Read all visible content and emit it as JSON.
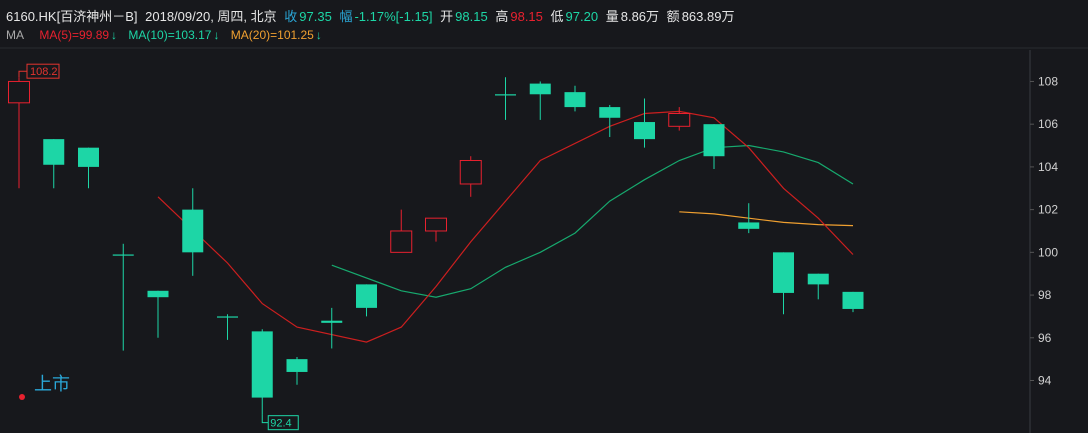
{
  "header": {
    "stock": "6160.HK[百济神州－B]",
    "date": "2018/09/20, 周四, 北京",
    "close_label": "收",
    "close": "97.35",
    "change_label": "幅",
    "change_pct": "-1.17%",
    "change_abs": "[-1.15]",
    "open_label": "开",
    "open": "98.15",
    "high_label": "高",
    "high": "98.15",
    "low_label": "低",
    "low": "97.20",
    "volume_label": "量",
    "volume": "8.86万",
    "amount_label": "额",
    "amount": "863.89万"
  },
  "ma_legend": {
    "label": "MA",
    "ma5": "MA(5)=99.89",
    "ma10": "MA(10)=103.17",
    "ma20": "MA(20)=101.25",
    "arrow": "↓"
  },
  "colors": {
    "up": "#e8212f",
    "down": "#1dd6a6",
    "ma5": "#cc1f1f",
    "ma10": "#17a96e",
    "ma20": "#f0a030",
    "axis_text": "#d0d0d0",
    "grid": "#2c2e33",
    "label_up": "#e3342f",
    "label_down": "#1dd6a6",
    "marker": "#e8212f",
    "event_text": "#2aa7d8"
  },
  "chart_data": {
    "type": "candlestick",
    "ylim": [
      92.0,
      109.5
    ],
    "yticks": [
      94,
      96,
      98,
      100,
      102,
      104,
      106,
      108
    ],
    "candles": [
      {
        "o": 107.0,
        "c": 108.0,
        "h": 108.2,
        "l": 103.0
      },
      {
        "o": 105.3,
        "c": 104.1,
        "h": 105.3,
        "l": 103.0
      },
      {
        "o": 104.9,
        "c": 104.0,
        "h": 104.9,
        "l": 103.0
      },
      {
        "o": 99.9,
        "c": 99.9,
        "h": 100.4,
        "l": 95.4
      },
      {
        "o": 98.2,
        "c": 97.9,
        "h": 98.2,
        "l": 96.0
      },
      {
        "o": 102.0,
        "c": 100.0,
        "h": 103.0,
        "l": 98.9
      },
      {
        "o": 97.0,
        "c": 97.0,
        "h": 97.1,
        "l": 95.9
      },
      {
        "o": 96.3,
        "c": 93.2,
        "h": 96.4,
        "l": 92.4
      },
      {
        "o": 95.0,
        "c": 94.4,
        "h": 95.1,
        "l": 93.8
      },
      {
        "o": 96.8,
        "c": 96.7,
        "h": 97.4,
        "l": 95.5
      },
      {
        "o": 98.5,
        "c": 97.4,
        "h": 98.5,
        "l": 97.0
      },
      {
        "o": 100.0,
        "c": 101.0,
        "h": 102.0,
        "l": 100.0
      },
      {
        "o": 101.0,
        "c": 101.6,
        "h": 101.6,
        "l": 100.5
      },
      {
        "o": 103.2,
        "c": 104.3,
        "h": 104.5,
        "l": 102.6
      },
      {
        "o": 107.4,
        "c": 107.4,
        "h": 108.2,
        "l": 106.2
      },
      {
        "o": 107.9,
        "c": 107.4,
        "h": 108.0,
        "l": 106.2
      },
      {
        "o": 107.5,
        "c": 106.8,
        "h": 107.8,
        "l": 106.6
      },
      {
        "o": 106.8,
        "c": 106.3,
        "h": 106.9,
        "l": 105.4
      },
      {
        "o": 106.1,
        "c": 105.3,
        "h": 107.2,
        "l": 104.9
      },
      {
        "o": 105.9,
        "c": 106.5,
        "h": 106.8,
        "l": 105.7
      },
      {
        "o": 106.0,
        "c": 104.5,
        "h": 106.0,
        "l": 103.9
      },
      {
        "o": 101.4,
        "c": 101.1,
        "h": 102.3,
        "l": 100.9
      },
      {
        "o": 100.0,
        "c": 98.1,
        "h": 100.0,
        "l": 97.1
      },
      {
        "o": 99.0,
        "c": 98.5,
        "h": 99.0,
        "l": 97.8
      },
      {
        "o": 98.15,
        "c": 97.35,
        "h": 98.15,
        "l": 97.2
      }
    ],
    "ma5": [
      [
        4,
        102.6
      ],
      [
        6,
        99.5
      ],
      [
        7,
        97.6
      ],
      [
        8,
        96.5
      ],
      [
        10,
        95.8
      ],
      [
        11,
        96.5
      ],
      [
        12,
        98.4
      ],
      [
        13,
        100.5
      ],
      [
        15,
        104.3
      ],
      [
        17,
        105.9
      ],
      [
        18,
        106.5
      ],
      [
        19,
        106.6
      ],
      [
        20,
        106.3
      ],
      [
        21,
        104.9
      ],
      [
        22,
        103.0
      ],
      [
        23,
        101.6
      ],
      [
        24,
        99.9
      ]
    ],
    "ma10": [
      [
        9,
        99.4
      ],
      [
        11,
        98.2
      ],
      [
        12,
        97.9
      ],
      [
        13,
        98.3
      ],
      [
        14,
        99.3
      ],
      [
        15,
        100.0
      ],
      [
        16,
        100.9
      ],
      [
        17,
        102.4
      ],
      [
        18,
        103.4
      ],
      [
        19,
        104.3
      ],
      [
        20,
        104.9
      ],
      [
        21,
        105.0
      ],
      [
        22,
        104.7
      ],
      [
        23,
        104.2
      ],
      [
        24,
        103.2
      ]
    ],
    "ma20": [
      [
        19,
        101.9
      ],
      [
        20,
        101.8
      ],
      [
        21,
        101.6
      ],
      [
        22,
        101.4
      ],
      [
        23,
        101.3
      ],
      [
        24,
        101.25
      ]
    ],
    "max_label": "108.2",
    "min_label": "92.4",
    "event_label": "上市"
  }
}
